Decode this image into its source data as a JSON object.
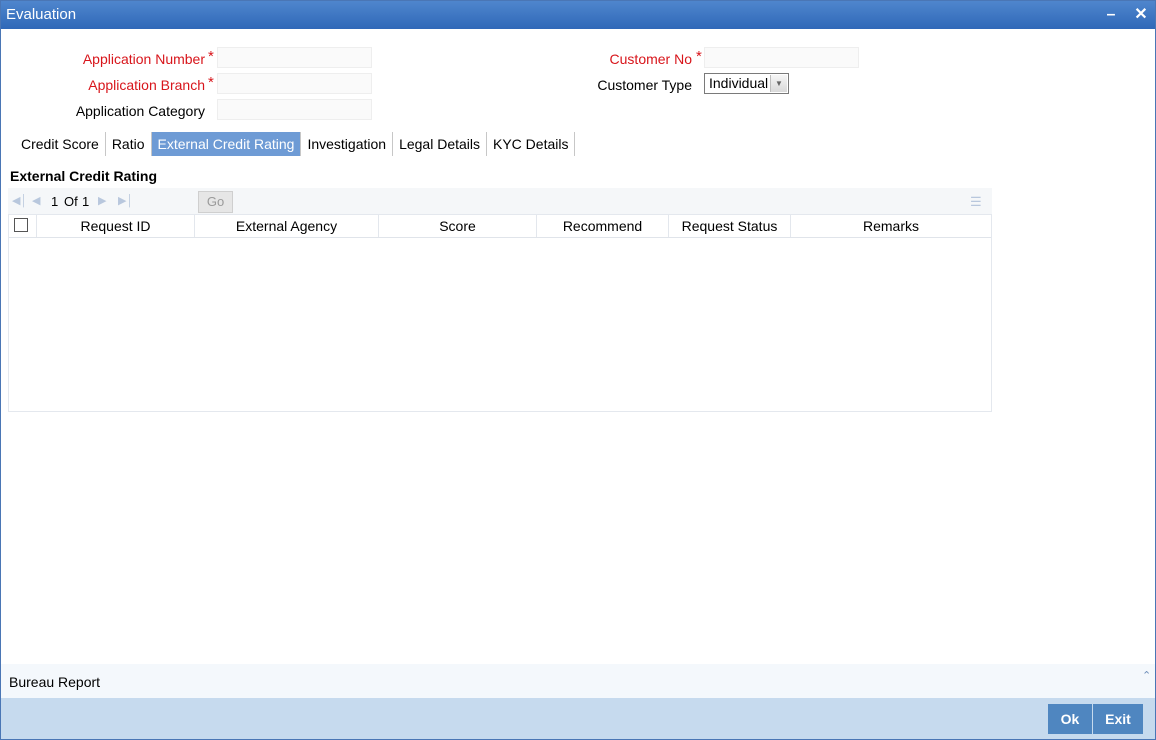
{
  "window": {
    "title": "Evaluation",
    "minimize_icon": "minimize-icon",
    "close_icon": "close-icon"
  },
  "form": {
    "application_number_label": "Application Number",
    "application_branch_label": "Application Branch",
    "application_category_label": "Application Category",
    "customer_no_label": "Customer No",
    "customer_type_label": "Customer Type",
    "required_mark": "*",
    "customer_type_value": "Individual"
  },
  "tabs": [
    {
      "label": "Credit Score"
    },
    {
      "label": "Ratio"
    },
    {
      "label": "External Credit Rating",
      "active": true
    },
    {
      "label": "Investigation"
    },
    {
      "label": "Legal Details"
    },
    {
      "label": "KYC Details"
    }
  ],
  "section": {
    "title": "External Credit Rating"
  },
  "pager": {
    "current": "1",
    "of_label": "Of",
    "total": "1",
    "go_label": "Go"
  },
  "grid": {
    "columns": [
      "Request ID",
      "External Agency",
      "Score",
      "Recommend",
      "Request Status",
      "Remarks"
    ],
    "rows": []
  },
  "footer": {
    "bureau_report": "Bureau Report",
    "ok_label": "Ok",
    "exit_label": "Exit"
  },
  "colors": {
    "title_bar": "#2f68b8",
    "required": "#d8151b",
    "active_tab": "#6e9bd5",
    "button": "#4f86c0",
    "bottom_bar": "#c6daee"
  }
}
